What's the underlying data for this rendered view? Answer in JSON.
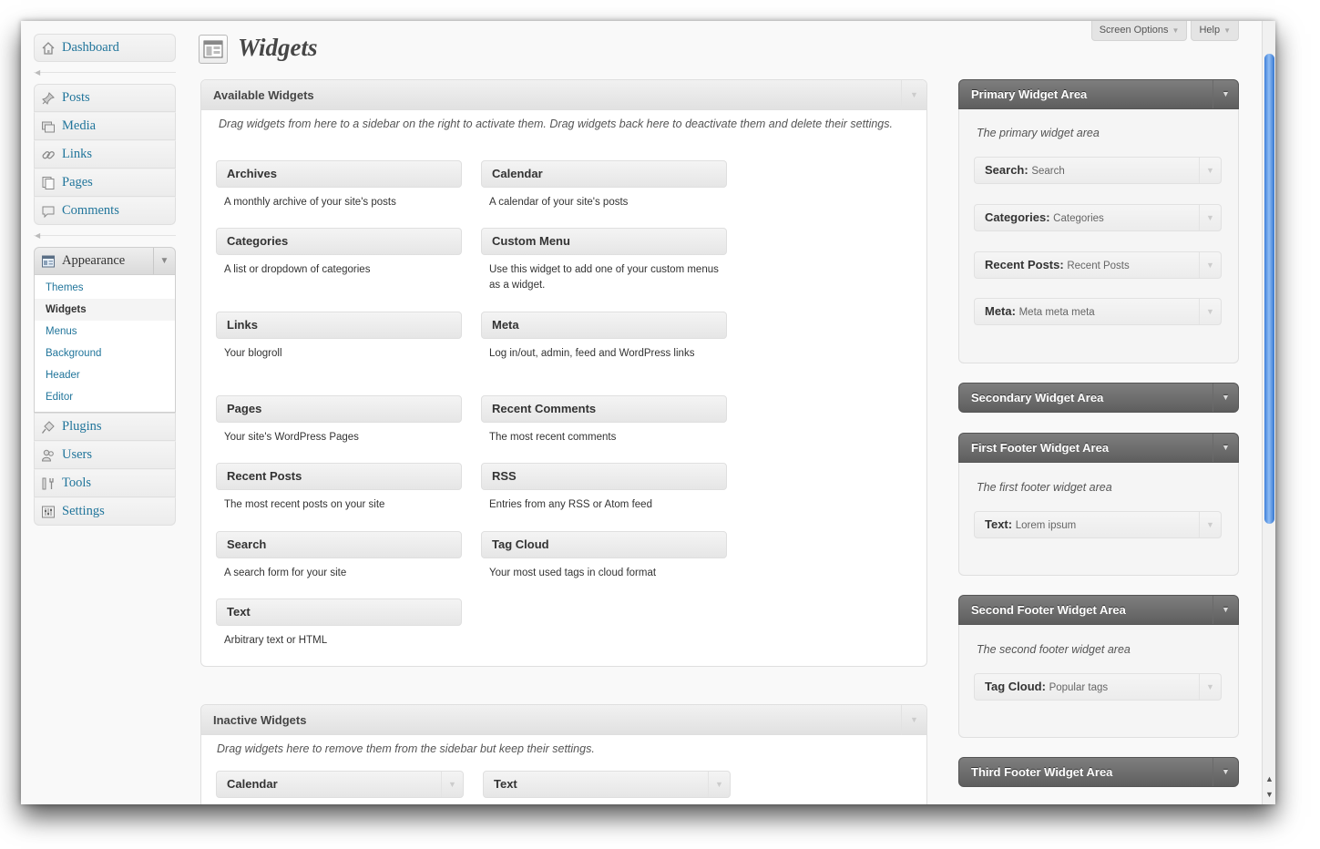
{
  "screen_meta": {
    "screen_options": "Screen Options",
    "help": "Help"
  },
  "menu": {
    "dashboard": "Dashboard",
    "group1": [
      "Posts",
      "Media",
      "Links",
      "Pages",
      "Comments"
    ],
    "appearance": "Appearance",
    "appearance_sub": [
      "Themes",
      "Widgets",
      "Menus",
      "Background",
      "Header",
      "Editor"
    ],
    "group2": [
      "Plugins",
      "Users",
      "Tools",
      "Settings"
    ]
  },
  "page_title": "Widgets",
  "available": {
    "title": "Available Widgets",
    "description": "Drag widgets from here to a sidebar on the right to activate them. Drag widgets back here to deactivate them and delete their settings.",
    "widgets": [
      {
        "name": "Archives",
        "desc": "A monthly archive of your site's posts"
      },
      {
        "name": "Calendar",
        "desc": "A calendar of your site's posts"
      },
      {
        "name": "Categories",
        "desc": "A list or dropdown of categories"
      },
      {
        "name": "Custom Menu",
        "desc": "Use this widget to add one of your custom menus as a widget."
      },
      {
        "name": "Links",
        "desc": "Your blogroll"
      },
      {
        "name": "Meta",
        "desc": "Log in/out, admin, feed and WordPress links"
      },
      {
        "name": "Pages",
        "desc": "Your site's WordPress Pages"
      },
      {
        "name": "Recent Comments",
        "desc": "The most recent comments"
      },
      {
        "name": "Recent Posts",
        "desc": "The most recent posts on your site"
      },
      {
        "name": "RSS",
        "desc": "Entries from any RSS or Atom feed"
      },
      {
        "name": "Search",
        "desc": "A search form for your site"
      },
      {
        "name": "Tag Cloud",
        "desc": "Your most used tags in cloud format"
      },
      {
        "name": "Text",
        "desc": "Arbitrary text or HTML"
      }
    ]
  },
  "inactive": {
    "title": "Inactive Widgets",
    "description": "Drag widgets here to remove them from the sidebar but keep their settings.",
    "widgets": [
      "Calendar",
      "Text"
    ]
  },
  "sidebars": {
    "primary": {
      "title": "Primary Widget Area",
      "description": "The primary widget area",
      "widgets": [
        {
          "name": "Search",
          "title": "Search"
        },
        {
          "name": "Categories",
          "title": "Categories"
        },
        {
          "name": "Recent Posts",
          "title": "Recent Posts"
        },
        {
          "name": "Meta",
          "title": "Meta meta meta"
        }
      ]
    },
    "secondary": {
      "title": "Secondary Widget Area"
    },
    "first_footer": {
      "title": "First Footer Widget Area",
      "description": "The first footer widget area",
      "widgets": [
        {
          "name": "Text",
          "title": "Lorem ipsum"
        }
      ]
    },
    "second_footer": {
      "title": "Second Footer Widget Area",
      "description": "The second footer widget area",
      "widgets": [
        {
          "name": "Tag Cloud",
          "title": "Popular tags"
        }
      ]
    },
    "third_footer": {
      "title": "Third Footer Widget Area"
    }
  },
  "colors": {
    "link": "#21759b",
    "sidebar_header": "#6e6e6e",
    "scroll_thumb": "#3e7fd8"
  }
}
